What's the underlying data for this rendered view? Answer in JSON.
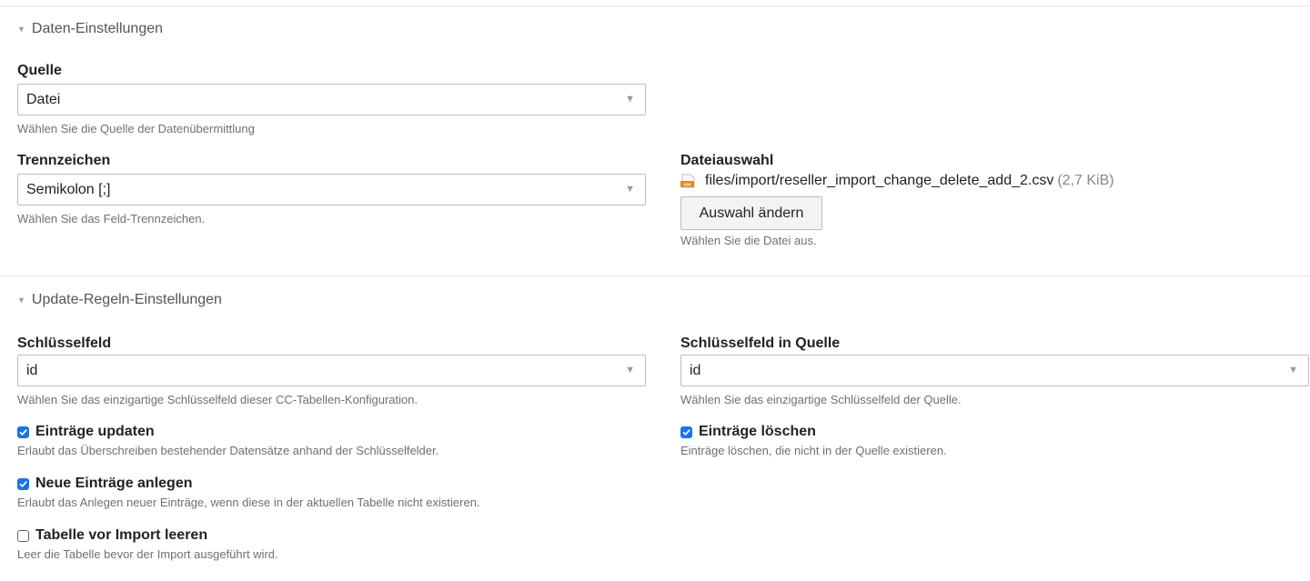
{
  "data_section": {
    "legend": "Daten-Einstellungen",
    "source": {
      "label": "Quelle",
      "value": "Datei",
      "help": "Wählen Sie die Quelle der Datenübermittlung"
    },
    "delimiter": {
      "label": "Trennzeichen",
      "value": "Semikolon [;]",
      "help": "Wählen Sie das Feld-Trennzeichen."
    },
    "file": {
      "label": "Dateiauswahl",
      "icon": "csv-file-icon",
      "path": "files/import/reseller_import_change_delete_add_2.csv",
      "size": "(2,7 KiB)",
      "change_button": "Auswahl ändern",
      "help": "Wählen Sie die Datei aus."
    }
  },
  "update_section": {
    "legend": "Update-Regeln-Einstellungen",
    "key_field": {
      "label": "Schlüsselfeld",
      "value": "id",
      "help": "Wählen Sie das einzigartige Schlüsselfeld dieser CC-Tabellen-Konfiguration."
    },
    "key_field_source": {
      "label": "Schlüsselfeld in Quelle",
      "value": "id",
      "help": "Wählen Sie das einzigartige Schlüsselfeld der Quelle."
    },
    "update_entries": {
      "label": "Einträge updaten",
      "checked": true,
      "help": "Erlaubt das Überschreiben bestehender Datensätze anhand der Schlüsselfelder."
    },
    "delete_entries": {
      "label": "Einträge löschen",
      "checked": true,
      "help": "Einträge löschen, die nicht in der Quelle existieren."
    },
    "create_entries": {
      "label": "Neue Einträge anlegen",
      "checked": true,
      "help": "Erlaubt das Anlegen neuer Einträge, wenn diese in der aktuellen Tabelle nicht existieren."
    },
    "truncate_table": {
      "label": "Tabelle vor Import leeren",
      "checked": false,
      "help": "Leer die Tabelle bevor der Import ausgeführt wird."
    }
  },
  "colors": {
    "accent": "#1a73e8",
    "help_text": "#707070",
    "border": "#bdbdbd"
  }
}
